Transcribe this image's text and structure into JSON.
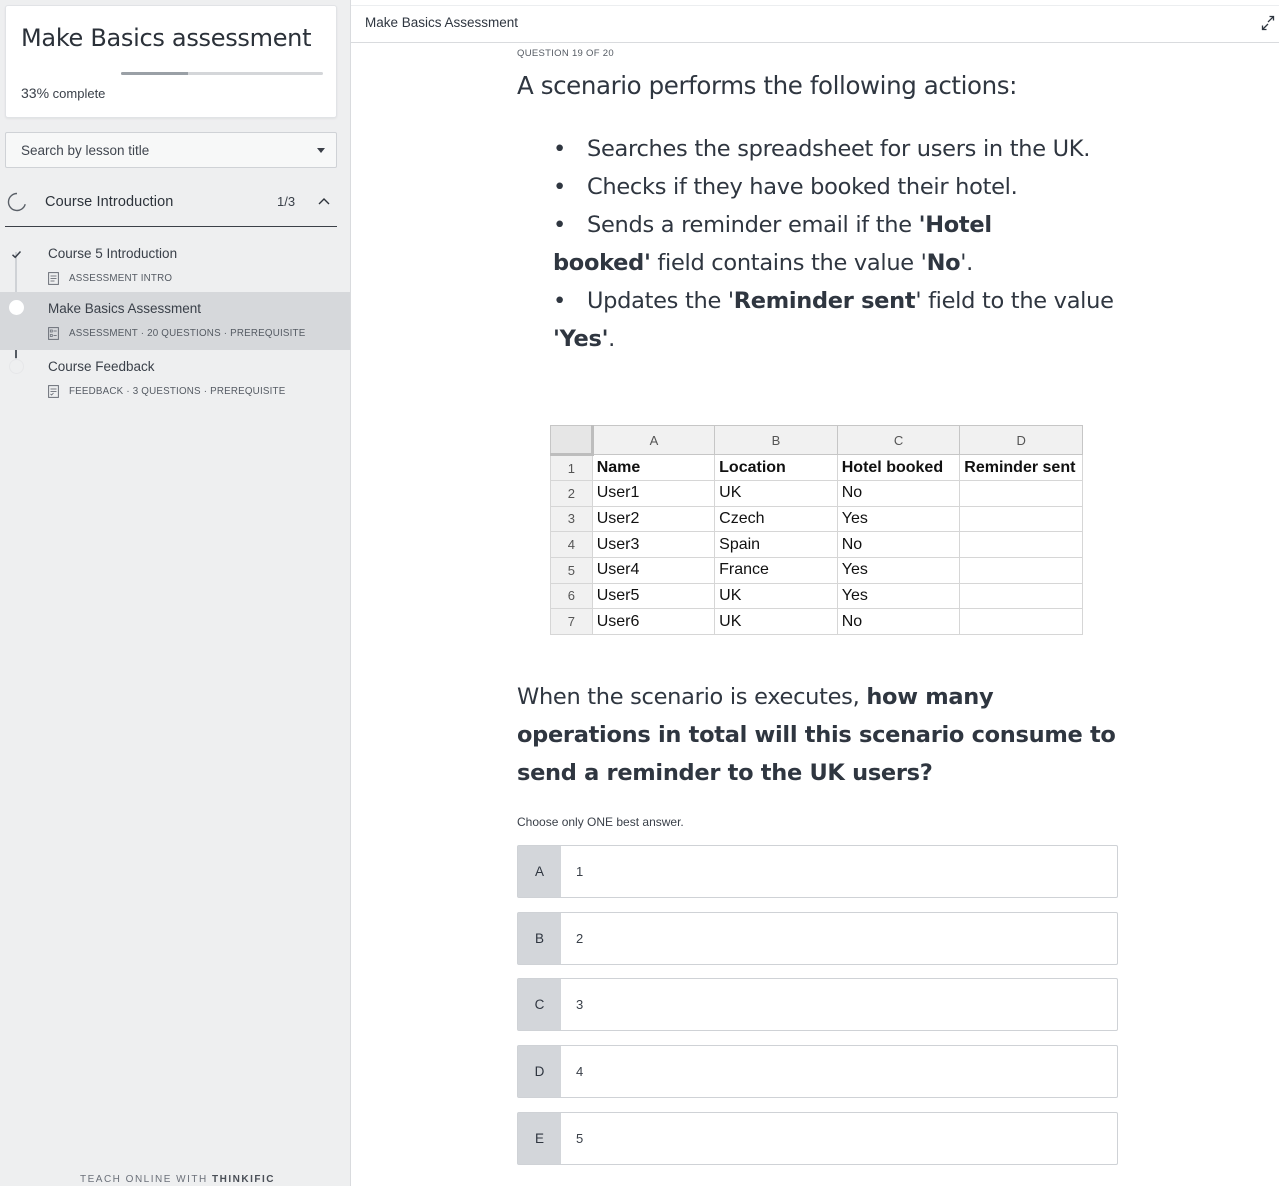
{
  "sidebar": {
    "course_title": "Make Basics assessment",
    "progress_value": 33,
    "progress_percent": "33%",
    "progress_suffix": "complete",
    "search_placeholder": "Search by lesson title",
    "chapter": {
      "title": "Course Introduction",
      "count": "1/3"
    },
    "lessons": [
      {
        "name": "Course 5 Introduction",
        "meta": "ASSESSMENT INTRO",
        "state": "completed",
        "icon": "document-icon"
      },
      {
        "name": "Make Basics Assessment",
        "meta": "ASSESSMENT · 20 QUESTIONS · PREREQUISITE",
        "state": "current",
        "icon": "quiz-icon"
      },
      {
        "name": "Course Feedback",
        "meta": "FEEDBACK · 3 QUESTIONS · PREREQUISITE",
        "state": "not-started",
        "icon": "survey-icon"
      }
    ],
    "footer_prefix": "TEACH ONLINE WITH",
    "footer_brand": "THINKIFIC"
  },
  "header": {
    "title": "Make Basics Assessment"
  },
  "question": {
    "number_label": "QUESTION 19 OF 20",
    "intro": "A scenario performs the following actions:",
    "bullets": {
      "b1": "Searches the spreadsheet for users in the UK.",
      "b2": "Checks if they have booked their hotel.",
      "b3_pre": "Sends a reminder email if the ",
      "b3_bold1": "'Hotel",
      "b3_bold2": "booked'",
      "b3_mid": " field contains the value '",
      "b3_bold3": "No",
      "b3_end": "'.",
      "b4_pre": "Updates the '",
      "b4_bold1": "Reminder sent",
      "b4_mid": "' field to the value",
      "b4_bold2": "'Yes'",
      "b4_end": "."
    },
    "sheet": {
      "columns": [
        "A",
        "B",
        "C",
        "D"
      ],
      "header_row": [
        "Name",
        "Location",
        "Hotel booked",
        "Reminder sent"
      ],
      "row_numbers": [
        "1",
        "2",
        "3",
        "4",
        "5",
        "6",
        "7"
      ],
      "rows": [
        [
          "User1",
          "UK",
          "No",
          ""
        ],
        [
          "User2",
          "Czech",
          "Yes",
          ""
        ],
        [
          "User3",
          "Spain",
          "No",
          ""
        ],
        [
          "User4",
          "France",
          "Yes",
          ""
        ],
        [
          "User5",
          "UK",
          "Yes",
          ""
        ],
        [
          "User6",
          "UK",
          "No",
          ""
        ]
      ]
    },
    "prompt_pre": "When the scenario is executes, ",
    "prompt_bold": "how many operations in total will this scenario consume to send a reminder to the UK users?",
    "instruction": "Choose only ONE best answer.",
    "options": [
      {
        "letter": "A",
        "value": "1"
      },
      {
        "letter": "B",
        "value": "2"
      },
      {
        "letter": "C",
        "value": "3"
      },
      {
        "letter": "D",
        "value": "4"
      },
      {
        "letter": "E",
        "value": "5"
      }
    ]
  }
}
